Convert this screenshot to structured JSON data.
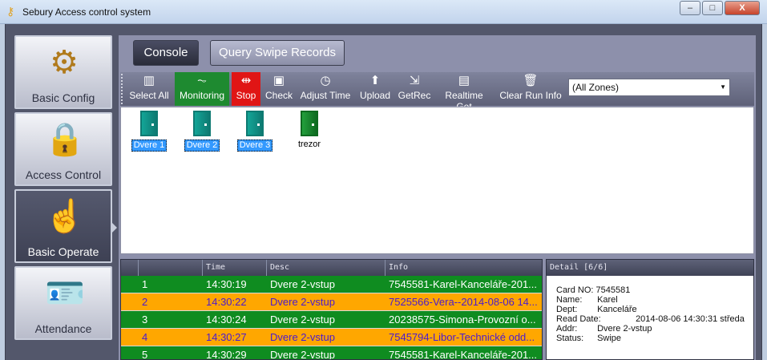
{
  "window": {
    "title": "Sebury Access control system",
    "controls": {
      "minimize": "–",
      "maximize": "□",
      "close": "X"
    }
  },
  "nav": {
    "items": [
      {
        "label": "Basic Config",
        "icon": "gear-icon"
      },
      {
        "label": "Access Control",
        "icon": "padlock-icon"
      },
      {
        "label": "Basic Operate",
        "icon": "hand-pointer-icon"
      },
      {
        "label": "Attendance",
        "icon": "id-card-icon"
      }
    ],
    "active": "Basic Operate"
  },
  "tabs": [
    {
      "label": "Console"
    },
    {
      "label": "Query Swipe Records"
    }
  ],
  "toolbar": {
    "items": [
      {
        "label": "Select All",
        "icon": "▥"
      },
      {
        "label": "Monitoring",
        "icon": "⏦"
      },
      {
        "label": "Stop",
        "icon": "⇹"
      },
      {
        "label": "Check",
        "icon": "▣"
      },
      {
        "label": "Adjust Time",
        "icon": "◷"
      },
      {
        "label": "Upload",
        "icon": "⬆"
      },
      {
        "label": "GetRec",
        "icon": "⇲"
      },
      {
        "label": "Realtime Get",
        "icon": "▤"
      },
      {
        "label": "Clear Run Info",
        "icon": "🗑"
      }
    ],
    "zone_select": "(All Zones)"
  },
  "doors": [
    {
      "label": "Dvere 1",
      "selected": true
    },
    {
      "label": "Dvere 2",
      "selected": true
    },
    {
      "label": "Dvere 3",
      "selected": true
    },
    {
      "label": "trezor",
      "selected": false
    }
  ],
  "grid": {
    "columns": [
      "",
      "",
      "Time",
      "Desc",
      "Info"
    ],
    "rows": [
      {
        "status": "ok",
        "no": "1",
        "time": "14:30:19",
        "desc": "Dvere 2-vstup",
        "info": "7545581-Karel-Kanceláře-201..."
      },
      {
        "status": "bad",
        "no": "2",
        "time": "14:30:22",
        "desc": "Dvere 2-vstup",
        "info": "7525566-Vera--2014-08-06 14..."
      },
      {
        "status": "ok",
        "no": "3",
        "time": "14:30:24",
        "desc": "Dvere 2-vstup",
        "info": "20238575-Simona-Provozní o..."
      },
      {
        "status": "bad",
        "no": "4",
        "time": "14:30:27",
        "desc": "Dvere 2-vstup",
        "info": "7545794-Libor-Technické odd..."
      },
      {
        "status": "ok",
        "no": "5",
        "time": "14:30:29",
        "desc": "Dvere 2-vstup",
        "info": "7545581-Karel-Kanceláře-201..."
      }
    ]
  },
  "detail": {
    "header": "Detail  [6/6]",
    "fields": [
      {
        "key": "Card NO:",
        "value": "7545581"
      },
      {
        "key": "Name:",
        "value": "Karel"
      },
      {
        "key": "Dept:",
        "value": "Kanceláře"
      },
      {
        "key": "Read Date:",
        "value": "2014-08-06 14:30:31 středa"
      },
      {
        "key": "Addr:",
        "value": "Dvere 2-vstup"
      },
      {
        "key": "Status:",
        "value": "Swipe"
      }
    ]
  },
  "colors": {
    "ok_row": "#0f8c20",
    "bad_row": "#ffa700",
    "monitoring": "#1e8a30",
    "stop": "#e01515"
  }
}
